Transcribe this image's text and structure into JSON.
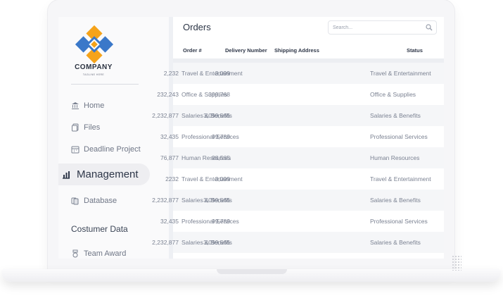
{
  "brand": {
    "name": "COMPANY",
    "tagline": "TAGLINE HERE",
    "colors": {
      "blue": "#3a78c9",
      "orange": "#f5a31a"
    }
  },
  "sidebar": {
    "items": [
      {
        "label": "Home",
        "icon": "bank-icon"
      },
      {
        "label": "Files",
        "icon": "files-icon"
      },
      {
        "label": "Deadline Project",
        "icon": "calendar-icon"
      },
      {
        "label": "Management",
        "icon": "chart-icon",
        "active": true
      },
      {
        "label": "Database",
        "icon": "database-icon"
      }
    ],
    "section_title": "Costumer Data",
    "section_items": [
      {
        "label": "Team Award",
        "icon": "award-icon"
      }
    ]
  },
  "main": {
    "title": "Orders",
    "search": {
      "placeholder": "Search...",
      "value": ""
    },
    "columns": [
      "Order #",
      "Delivery Number",
      "Shipping Address",
      "Status"
    ],
    "rows": [
      [
        "Travel & Entertainment",
        "2,232",
        "3,099",
        "Travel & Entertainment"
      ],
      [
        "Office & Supplies",
        "232,243",
        "399,768",
        "Office & Supplies"
      ],
      [
        "Salaries & Benefits",
        "2,232,877",
        "3,099,565",
        "Salaries & Benefits"
      ],
      [
        "Professional Services",
        "32,435",
        "99,789",
        "Professional Services"
      ],
      [
        "Human Resources",
        "76,877",
        "98,565",
        "Human Resources"
      ],
      [
        "Travel & Entertainment",
        "2232",
        "3,099",
        "Travel & Entertainment"
      ],
      [
        "Salaries & Benefits",
        "2,232,877",
        "3,099,565",
        "Salaries & Benefits"
      ],
      [
        "Professional Services",
        "32,435",
        "99,789",
        "Professional Services"
      ],
      [
        "Salaries & Benefits",
        "2,232,877",
        "3,099,565",
        "Salaries & Benefits"
      ]
    ]
  }
}
